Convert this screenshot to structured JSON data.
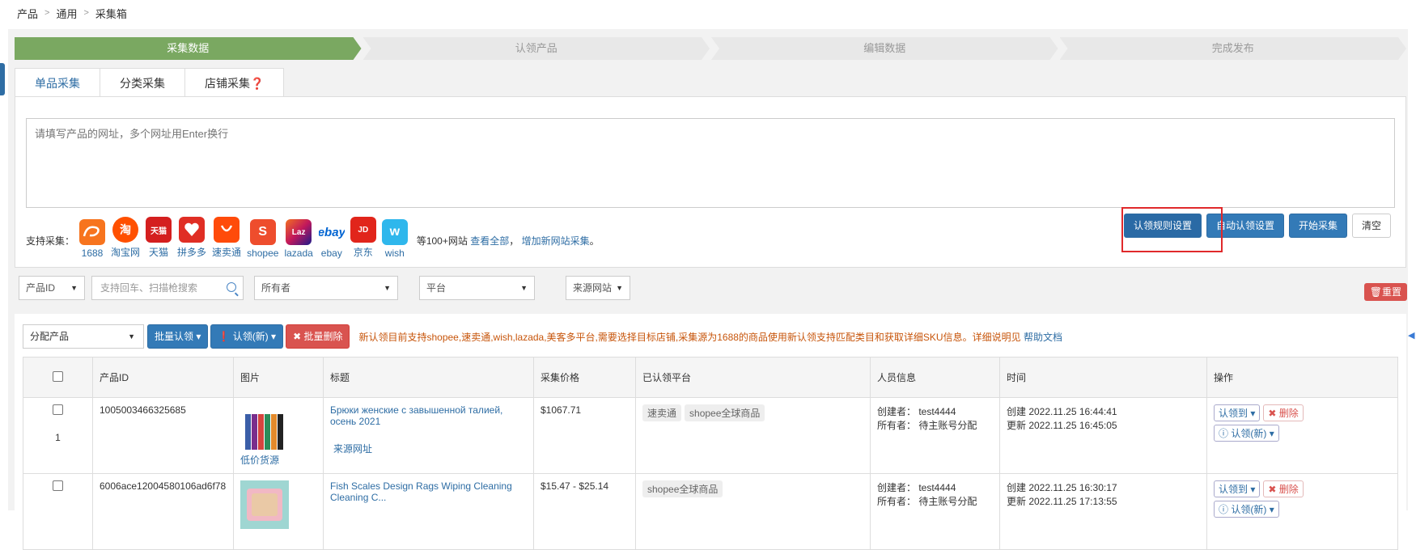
{
  "breadcrumb": {
    "items": [
      "产品",
      "通用",
      "采集箱"
    ]
  },
  "steps": [
    "采集数据",
    "认领产品",
    "编辑数据",
    "完成发布"
  ],
  "tabs": [
    {
      "label": "单品采集"
    },
    {
      "label": "分类采集"
    },
    {
      "label": "店铺采集❓"
    }
  ],
  "collect": {
    "placeholder": "请填写产品的网址，多个网址用Enter换行",
    "support_label": "支持采集：",
    "platforms": [
      {
        "name": "1688",
        "color": "#f7741e",
        "icon": "1688-icon"
      },
      {
        "name": "淘宝网",
        "color": "#ff5000",
        "icon": "taobao-icon",
        "glyph": "淘"
      },
      {
        "name": "天猫",
        "color": "#d41f1f",
        "icon": "tmall-icon",
        "glyph": "天猫"
      },
      {
        "name": "拼多多",
        "color": "#e02e24",
        "icon": "pinduoduo-icon"
      },
      {
        "name": "速卖通",
        "color": "#ff4b0a",
        "icon": "aliexpress-icon"
      },
      {
        "name": "shopee",
        "color": "#ee4d2d",
        "icon": "shopee-icon",
        "glyph": "S"
      },
      {
        "name": "lazada",
        "color": "#1c1a8c",
        "icon": "lazada-icon",
        "glyph": "Laz"
      },
      {
        "name": "ebay",
        "color": "#ffffff",
        "icon": "ebay-icon",
        "glyph": "ebay"
      },
      {
        "name": "京东",
        "color": "#e1251b",
        "icon": "jd-icon",
        "glyph": "JD"
      },
      {
        "name": "wish",
        "color": "#2fb7ec",
        "icon": "wish-icon",
        "glyph": "w"
      }
    ],
    "more_text": "等100+网站",
    "view_all": "查看全部",
    "comma": "，",
    "add_site": "增加新网站采集",
    "period": "。",
    "buttons": {
      "rules": "认领规则设置",
      "auto": "自动认领设置",
      "start": "开始采集",
      "clear": "清空"
    }
  },
  "filters": {
    "product_id": "产品ID",
    "search_placeholder": "支持回车、扫描枪搜索",
    "owner": "所有者",
    "platform": "平台",
    "source": "来源网站",
    "reset": "🗑重置"
  },
  "actions": {
    "assign": "分配产品",
    "batch_claim": "批量认领",
    "claim_new": "认领(新)",
    "batch_delete": "批量删除",
    "notice": "新认领目前支持shopee,速卖通,wish,lazada,美客多平台,需要选择目标店铺,采集源为1688的商品使用新认领支持匹配类目和获取详细SKU信息。详细说明见",
    "help": "帮助文档"
  },
  "table": {
    "headers": [
      "产品ID",
      "图片",
      "标题",
      "采集价格",
      "已认领平台",
      "人员信息",
      "时间",
      "操作"
    ],
    "rows": [
      {
        "index": "1",
        "id": "1005003466325685",
        "img_label": "低价货源",
        "title": "Брюки женские с завышенной талией, осень 2021",
        "source_link": "来源网址",
        "price": "$1067.71",
        "platforms": [
          "速卖通",
          "shopee全球商品"
        ],
        "creator": "创建者： test4444",
        "owner": "所有者： 待主账号分配",
        "created": "创建 2022.11.25 16:44:41",
        "updated": "更新 2022.11.25 16:45:05",
        "op_claim": "认领到",
        "op_delete": "删除",
        "op_claim_new": "认领(新)"
      },
      {
        "index": "",
        "id": "6006ace12004580106ad6f78",
        "img_label": "",
        "title": "Fish Scales Design Rags Wiping Cleaning Cleaning C...",
        "source_link": "",
        "price": "$15.47 - $25.14",
        "platforms": [
          "shopee全球商品"
        ],
        "creator": "创建者： test4444",
        "owner": "所有者： 待主账号分配",
        "created": "创建 2022.11.25 16:30:17",
        "updated": "更新 2022.11.25 17:13:55",
        "op_claim": "认领到",
        "op_delete": "删除",
        "op_claim_new": "认领(新)"
      }
    ]
  }
}
